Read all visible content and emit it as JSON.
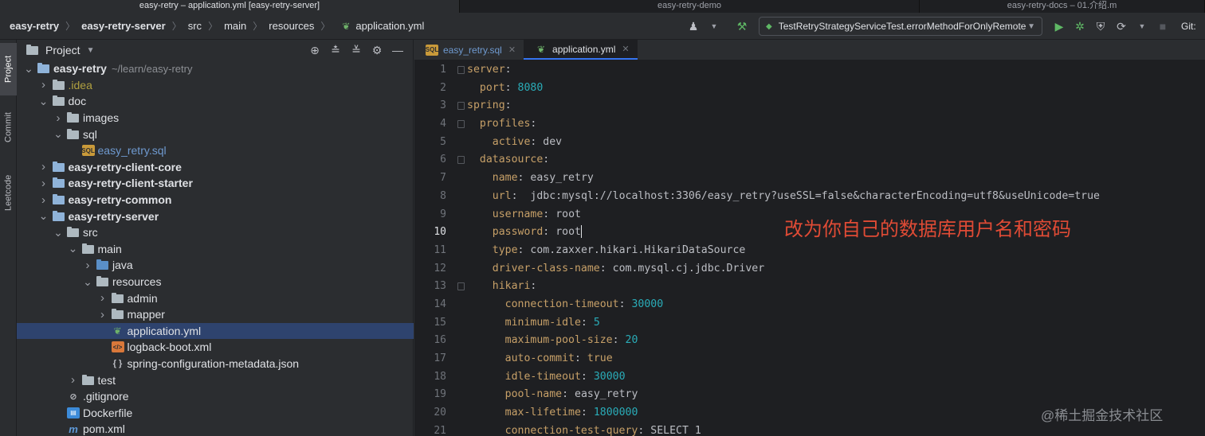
{
  "window_tabs": [
    "easy-retry – application.yml [easy-retry-server]",
    "easy-retry-demo",
    "easy-retry-docs – 01.介绍.m"
  ],
  "breadcrumb": [
    "easy-retry",
    "easy-retry-server",
    "src",
    "main",
    "resources",
    "application.yml"
  ],
  "toolbar": {
    "run_config": "TestRetryStrategyServiceTest.errorMethodForOnlyRemote",
    "git_label": "Git:"
  },
  "left_stripe": [
    "Project",
    "Commit",
    "Leetcode"
  ],
  "project_panel": {
    "title": "Project",
    "tree": [
      {
        "label": "easy-retry",
        "path": "~/learn/easy-retry",
        "depth": 0,
        "arrow": "down",
        "icon": "module-folder",
        "bold": true
      },
      {
        "label": ".idea",
        "depth": 1,
        "arrow": "right",
        "icon": "folder",
        "style": "idea"
      },
      {
        "label": "doc",
        "depth": 1,
        "arrow": "down",
        "icon": "folder"
      },
      {
        "label": "images",
        "depth": 2,
        "arrow": "right",
        "icon": "folder"
      },
      {
        "label": "sql",
        "depth": 2,
        "arrow": "down",
        "icon": "folder"
      },
      {
        "label": "easy_retry.sql",
        "depth": 3,
        "arrow": "none",
        "icon": "sql-file",
        "style": "sqlf"
      },
      {
        "label": "easy-retry-client-core",
        "depth": 1,
        "arrow": "right",
        "icon": "module-folder",
        "bold": true
      },
      {
        "label": "easy-retry-client-starter",
        "depth": 1,
        "arrow": "right",
        "icon": "module-folder",
        "bold": true
      },
      {
        "label": "easy-retry-common",
        "depth": 1,
        "arrow": "right",
        "icon": "module-folder",
        "bold": true
      },
      {
        "label": "easy-retry-server",
        "depth": 1,
        "arrow": "down",
        "icon": "module-folder",
        "bold": true
      },
      {
        "label": "src",
        "depth": 2,
        "arrow": "down",
        "icon": "folder"
      },
      {
        "label": "main",
        "depth": 3,
        "arrow": "down",
        "icon": "folder"
      },
      {
        "label": "java",
        "depth": 4,
        "arrow": "right",
        "icon": "source-folder"
      },
      {
        "label": "resources",
        "depth": 4,
        "arrow": "down",
        "icon": "resources-folder"
      },
      {
        "label": "admin",
        "depth": 5,
        "arrow": "right",
        "icon": "folder"
      },
      {
        "label": "mapper",
        "depth": 5,
        "arrow": "right",
        "icon": "folder"
      },
      {
        "label": "application.yml",
        "depth": 5,
        "arrow": "none",
        "icon": "yml-file",
        "selected": true
      },
      {
        "label": "logback-boot.xml",
        "depth": 5,
        "arrow": "none",
        "icon": "xml-file"
      },
      {
        "label": "spring-configuration-metadata.json",
        "depth": 5,
        "arrow": "none",
        "icon": "json-file"
      },
      {
        "label": "test",
        "depth": 3,
        "arrow": "right",
        "icon": "folder"
      },
      {
        "label": ".gitignore",
        "depth": 2,
        "arrow": "none",
        "icon": "git-file"
      },
      {
        "label": "Dockerfile",
        "depth": 2,
        "arrow": "none",
        "icon": "docker-file"
      },
      {
        "label": "pom.xml",
        "depth": 2,
        "arrow": "none",
        "icon": "maven-file"
      }
    ]
  },
  "editor": {
    "tabs": [
      {
        "label": "easy_retry.sql",
        "icon": "sql-file",
        "active": false
      },
      {
        "label": "application.yml",
        "icon": "yml-file",
        "active": true
      }
    ],
    "current_line": 10,
    "lines": [
      {
        "n": "1",
        "indent": "",
        "key": "server",
        "value": ""
      },
      {
        "n": "2",
        "indent": "  ",
        "key": "port",
        "value": "8080",
        "num": true
      },
      {
        "n": "3",
        "indent": "",
        "key": "spring",
        "value": ""
      },
      {
        "n": "4",
        "indent": "  ",
        "key": "profiles",
        "value": ""
      },
      {
        "n": "5",
        "indent": "    ",
        "key": "active",
        "value": "dev"
      },
      {
        "n": "6",
        "indent": "  ",
        "key": "datasource",
        "value": ""
      },
      {
        "n": "7",
        "indent": "    ",
        "key": "name",
        "value": "easy_retry"
      },
      {
        "n": "8",
        "indent": "    ",
        "key": "url",
        "value": " jdbc:mysql://localhost:3306/easy_retry?useSSL=false&characterEncoding=utf8&useUnicode=true"
      },
      {
        "n": "9",
        "indent": "    ",
        "key": "username",
        "value": "root"
      },
      {
        "n": "10",
        "indent": "    ",
        "key": "password",
        "value": "root"
      },
      {
        "n": "11",
        "indent": "    ",
        "key": "type",
        "value": "com.zaxxer.hikari.HikariDataSource"
      },
      {
        "n": "12",
        "indent": "    ",
        "key": "driver-class-name",
        "value": "com.mysql.cj.jdbc.Driver"
      },
      {
        "n": "13",
        "indent": "    ",
        "key": "hikari",
        "value": ""
      },
      {
        "n": "14",
        "indent": "      ",
        "key": "connection-timeout",
        "value": "30000",
        "num": true
      },
      {
        "n": "15",
        "indent": "      ",
        "key": "minimum-idle",
        "value": "5",
        "num": true
      },
      {
        "n": "16",
        "indent": "      ",
        "key": "maximum-pool-size",
        "value": "20",
        "num": true
      },
      {
        "n": "17",
        "indent": "      ",
        "key": "auto-commit",
        "value": "true",
        "kw": true
      },
      {
        "n": "18",
        "indent": "      ",
        "key": "idle-timeout",
        "value": "30000",
        "num": true
      },
      {
        "n": "19",
        "indent": "      ",
        "key": "pool-name",
        "value": "easy_retry"
      },
      {
        "n": "20",
        "indent": "      ",
        "key": "max-lifetime",
        "value": "1800000",
        "num": true
      },
      {
        "n": "21",
        "indent": "      ",
        "key": "connection-test-query",
        "value": "SELECT 1"
      }
    ]
  },
  "annotation": "改为你自己的数据库用户名和密码",
  "watermark": "@稀土掘金技术社区",
  "colors": {
    "annotation": "#e04b35",
    "selection": "#2e436e",
    "yaml_key": "#c7a068",
    "number": "#2aacb8"
  }
}
